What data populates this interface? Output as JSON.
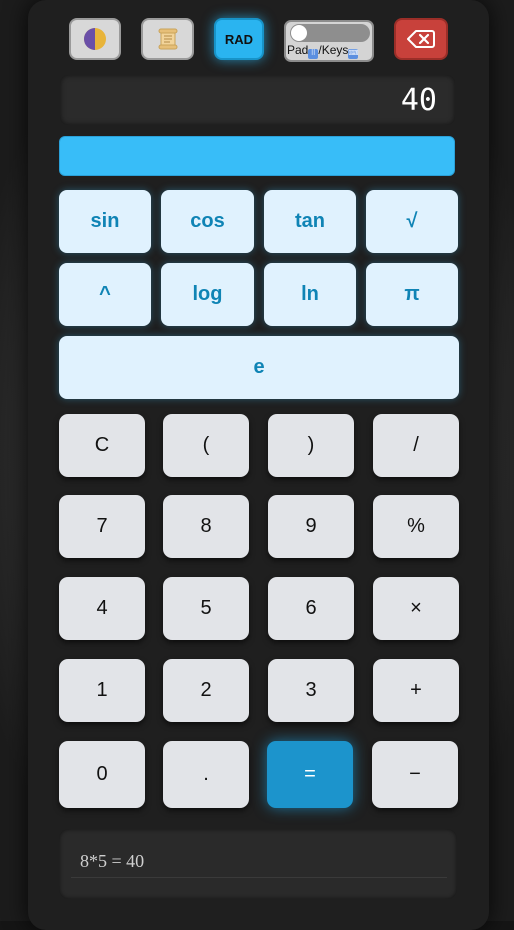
{
  "toolbar": {
    "mode_label": "RAD",
    "input_toggle": {
      "left": "Pad",
      "right": "/Keys",
      "state": "off"
    },
    "icons": {
      "theme": "half-moon-theme-icon",
      "history": "scroll-history-icon",
      "backspace": "backspace-icon"
    }
  },
  "display": {
    "value": "40"
  },
  "scientific": {
    "rows": [
      [
        "sin",
        "cos",
        "tan",
        "√"
      ],
      [
        "^",
        "log",
        "ln",
        "π"
      ],
      [
        "e"
      ]
    ]
  },
  "keypad": {
    "rows": [
      [
        "C",
        "(",
        ")",
        "/"
      ],
      [
        "7",
        "8",
        "9",
        "%"
      ],
      [
        "4",
        "5",
        "6",
        "×"
      ],
      [
        "1",
        "2",
        "3",
        "+"
      ],
      [
        "0",
        ".",
        "=",
        "−"
      ]
    ]
  },
  "history": {
    "entries": [
      "8*5 = 40"
    ]
  },
  "colors": {
    "accent": "#38bdf8",
    "equals": "#1c94cc",
    "backspace": "#c8413b",
    "sci_bg": "#e0f2fe",
    "sci_text": "#0f84b5",
    "key_bg": "#e2e4e8"
  }
}
